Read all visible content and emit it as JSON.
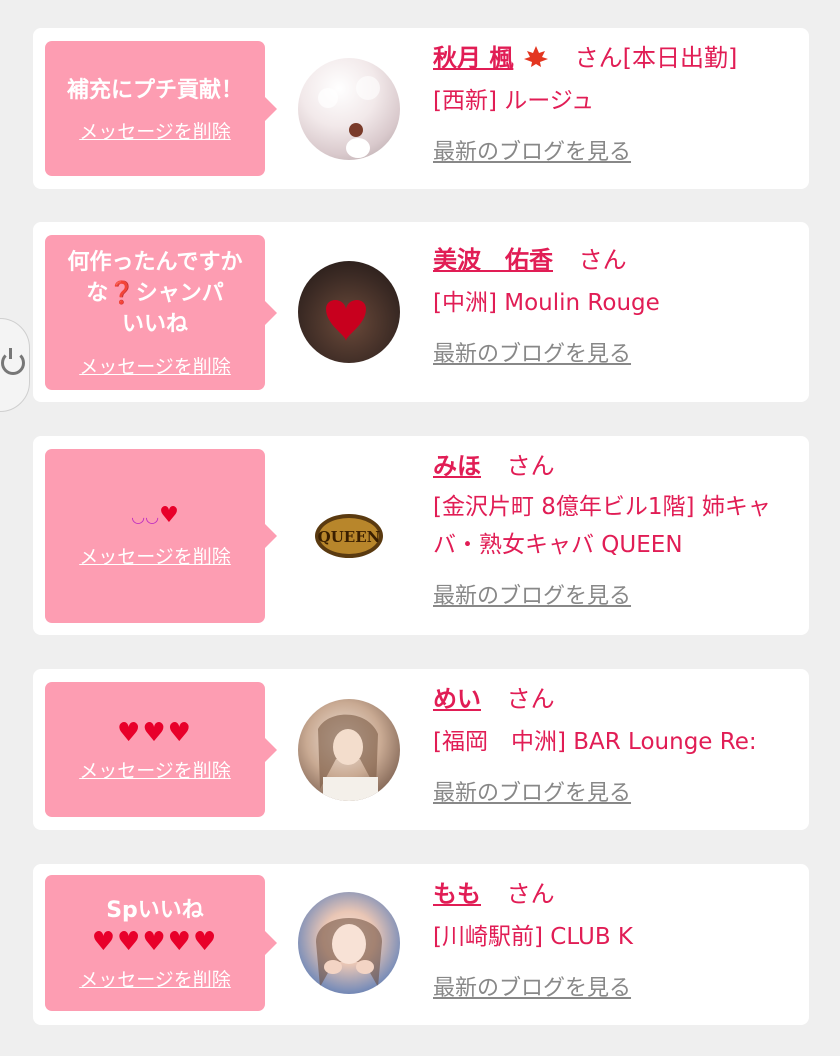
{
  "colors": {
    "accent": "#e11d55",
    "bubble": "#fd9db2",
    "link_gray": "#888888"
  },
  "messages": [
    {
      "message": "補充にプチ貢献！",
      "delete_label": "メッセージを削除",
      "name": "秋月 楓",
      "name_icon": "maple-leaf-icon",
      "suffix": "さん[本日出勤]",
      "shop": "[西新] ルージュ",
      "blog_label": "最新のブログを見る"
    },
    {
      "message": "何作ったんですか\nな❓シャンパ\nいいね",
      "delete_label": "メッセージを削除",
      "name": "美波　佑香",
      "suffix": "さん",
      "shop": "[中洲] Moulin Rouge",
      "blog_label": "最新のブログを見る"
    },
    {
      "message": "",
      "delete_label": "メッセージを削除",
      "name": "みほ",
      "suffix": "さん",
      "shop": "[金沢片町 8億年ビル1階] 姉キャバ・熟女キャバ QUEEN",
      "avatar_text": "QUEEN",
      "blog_label": "最新のブログを見る"
    },
    {
      "message": "♥♥♥",
      "delete_label": "メッセージを削除",
      "name": "めい",
      "suffix": "さん",
      "shop": "[福岡　中洲] BAR Lounge Re:",
      "blog_label": "最新のブログを見る"
    },
    {
      "message": "Spいいね",
      "message_hearts": "♥♥♥♥♥",
      "delete_label": "メッセージを削除",
      "name": "もも",
      "suffix": "さん",
      "shop": "[川崎駅前] CLUB K",
      "blog_label": "最新のブログを見る"
    }
  ]
}
